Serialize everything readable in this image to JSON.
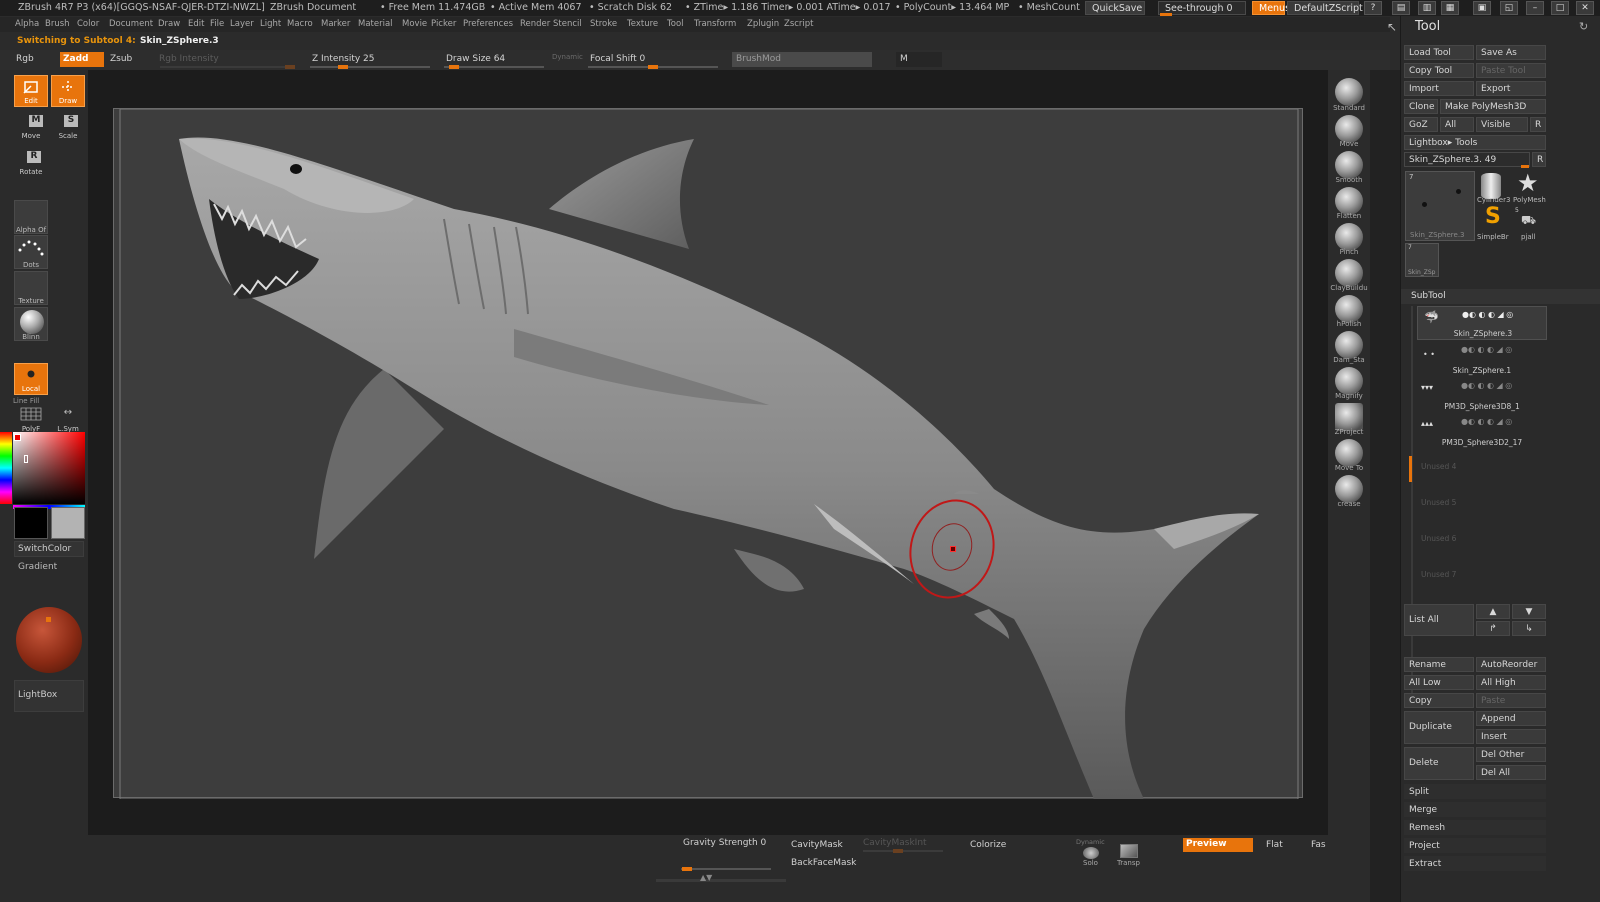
{
  "titlebar": {
    "app": "ZBrush 4R7 P3 (x64)[GGQS-NSAF-QJER-DTZI-NWZL]",
    "document": "ZBrush Document",
    "free_mem": "• Free Mem 11.474GB",
    "active_mem": "• Active Mem 4067",
    "scratch": "• Scratch Disk 62",
    "ztime": "• ZTime▸ 1.186  Timer▸ 0.001  ATime▸ 0.017",
    "polycount": "• PolyCount▸ 13.464 MP",
    "meshcount": "• MeshCount",
    "quicksave": "QuickSave",
    "seethrough": "See-through  0",
    "menus": "Menus",
    "defaultzscript": "DefaultZScript"
  },
  "menubar": [
    "Alpha",
    "Brush",
    "Color",
    "Document",
    "Draw",
    "Edit",
    "File",
    "Layer",
    "Light",
    "Macro",
    "Marker",
    "Material",
    "Movie",
    "Picker",
    "Preferences",
    "Render",
    "Stencil",
    "Stroke",
    "Texture",
    "Tool",
    "Transform",
    "Zplugin",
    "Zscript"
  ],
  "infoline": {
    "prefix": "Switching to Subtool 4:",
    "name": "Skin_ZSphere.3"
  },
  "toolbar": {
    "rgb": "Rgb",
    "zadd": "Zadd",
    "zsub": "Zsub",
    "rgb_intensity": "Rgb Intensity",
    "z_intensity": "Z Intensity 25",
    "draw_size": "Draw Size 64",
    "dynamic": "Dynamic",
    "focal_shift": "Focal Shift 0",
    "brushmod": "BrushMod",
    "m": "M",
    "z_intensity_level": 0.25,
    "draw_size_level": 0.06,
    "focal_shift_level": 0.5
  },
  "leftshelf": {
    "edit": "Edit",
    "draw": "Draw",
    "move": "Move",
    "scale": "Scale",
    "rotate": "Rotate",
    "alpha": "Alpha  Of",
    "dots": "Dots",
    "texture": "Texture",
    "blinn": "Blinn",
    "local": "Local",
    "line_fill": "Line Fill",
    "polyf": "PolyF",
    "lsym": "L.Sym",
    "switchcolor": "SwitchColor",
    "gradient": "Gradient",
    "lightbox": "LightBox",
    "color_main": "#000000",
    "color_secondary": "#b3b3b3"
  },
  "brushes": [
    "Standard",
    "Move",
    "Smooth",
    "Flatten",
    "Pinch",
    "ClayBuildu",
    "hPolish",
    "Dam_Sta",
    "Magnify",
    "ZProject",
    "Move  To",
    "crease"
  ],
  "toolpalette": {
    "title": "Tool",
    "load_tool": "Load Tool",
    "save_as": "Save As",
    "copy_tool": "Copy Tool",
    "paste_tool": "Paste Tool",
    "import": "Import",
    "export": "Export",
    "clone": "Clone",
    "make_polymesh": "Make PolyMesh3D",
    "goz": "GoZ",
    "all": "All",
    "visible": "Visible",
    "r": "R",
    "lightbox_tools": "Lightbox▸ Tools",
    "current_tool": "Skin_ZSphere.3. 49",
    "thumb_count": "7",
    "thumb_main_label": "Skin_ZSphere.3",
    "cylinder": "Cylinder3",
    "polymesh": "PolyMesh",
    "simplebrush": "SimpleBr",
    "pjall": "pjall",
    "small_count": "5",
    "thumb_small_count": "7",
    "thumb_small_label": "Skin_ZSp"
  },
  "subtool": {
    "title": "SubTool",
    "items": [
      "Skin_ZSphere.3",
      "Skin_ZSphere.1",
      "PM3D_Sphere3D8_1",
      "PM3D_Sphere3D2_17"
    ],
    "unused": [
      "Unused 4",
      "Unused 5",
      "Unused 6",
      "Unused 7"
    ],
    "list_all": "List All",
    "rename": "Rename",
    "autoreorder": "AutoReorder",
    "all_low": "All Low",
    "all_high": "All High",
    "copy": "Copy",
    "paste": "Paste",
    "duplicate": "Duplicate",
    "append": "Append",
    "insert": "Insert",
    "delete": "Delete",
    "del_other": "Del Other",
    "del_all": "Del All",
    "split": "Split",
    "merge": "Merge",
    "remesh": "Remesh",
    "project": "Project",
    "extract": "Extract"
  },
  "bottombar": {
    "gravity": "Gravity Strength 0",
    "cavitymask": "CavityMask",
    "cavitymaskint": "CavityMaskInt",
    "backfacemask": "BackFaceMask",
    "colorize": "Colorize",
    "dynamic": "Dynamic",
    "solo": "Solo",
    "transp": "Transp",
    "preview": "Preview",
    "flat": "Flat",
    "fast": "Fas"
  }
}
